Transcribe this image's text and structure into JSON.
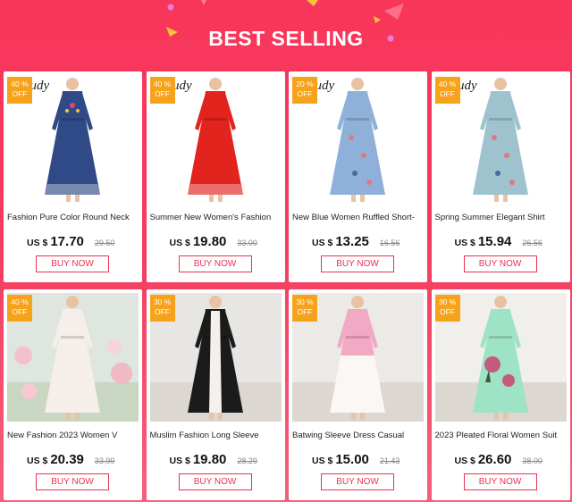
{
  "banner": {
    "title": "BEST SELLING"
  },
  "brand_watermark": "oudy",
  "products": [
    {
      "discount_pct": "40 %",
      "discount_word": "OFF",
      "name": "Fashion Pure Color Round Neck",
      "currency": "US $",
      "price": "17.70",
      "old_price": "29.50",
      "buy_label": "BUY NOW",
      "dress_color": "#2f4a86",
      "bg": "#ffffff",
      "watermark": true
    },
    {
      "discount_pct": "40 %",
      "discount_word": "OFF",
      "name": "Summer New Women's Fashion",
      "currency": "US $",
      "price": "19.80",
      "old_price": "33.00",
      "buy_label": "BUY NOW",
      "dress_color": "#e2231e",
      "bg": "#ffffff",
      "watermark": true
    },
    {
      "discount_pct": "20 %",
      "discount_word": "OFF",
      "name": "New Blue Women Ruffled Short-",
      "currency": "US $",
      "price": "13.25",
      "old_price": "16.56",
      "buy_label": "BUY NOW",
      "dress_color": "#8fb1d9",
      "bg": "#ffffff",
      "watermark": true
    },
    {
      "discount_pct": "40 %",
      "discount_word": "OFF",
      "name": "Spring Summer Elegant Shirt",
      "currency": "US $",
      "price": "15.94",
      "old_price": "26.56",
      "buy_label": "BUY NOW",
      "dress_color": "#9fc2cf",
      "bg": "#ffffff",
      "watermark": true
    },
    {
      "discount_pct": "40 %",
      "discount_word": "OFF",
      "name": "New Fashion 2023 Women V",
      "currency": "US $",
      "price": "20.39",
      "old_price": "33.99",
      "buy_label": "BUY NOW",
      "dress_color": "#f6eee9",
      "bg": "#dfe6df",
      "watermark": false
    },
    {
      "discount_pct": "30 %",
      "discount_word": "OFF",
      "name": "Muslim Fashion Long Sleeve",
      "currency": "US $",
      "price": "19.80",
      "old_price": "28.29",
      "buy_label": "BUY NOW",
      "dress_color": "#1b1b1b",
      "bg": "#e7e6e3",
      "watermark": false
    },
    {
      "discount_pct": "30 %",
      "discount_word": "OFF",
      "name": "Batwing Sleeve Dress Casual",
      "currency": "US $",
      "price": "15.00",
      "old_price": "21.43",
      "buy_label": "BUY NOW",
      "dress_color": "#f2a9c3",
      "bg": "#eceae7",
      "watermark": false
    },
    {
      "discount_pct": "30 %",
      "discount_word": "OFF",
      "name": "2023 Pleated Floral Women Suit",
      "currency": "US $",
      "price": "26.60",
      "old_price": "38.00",
      "buy_label": "BUY NOW",
      "dress_color": "#9fe3c6",
      "bg": "#f1efec",
      "watermark": false
    }
  ]
}
